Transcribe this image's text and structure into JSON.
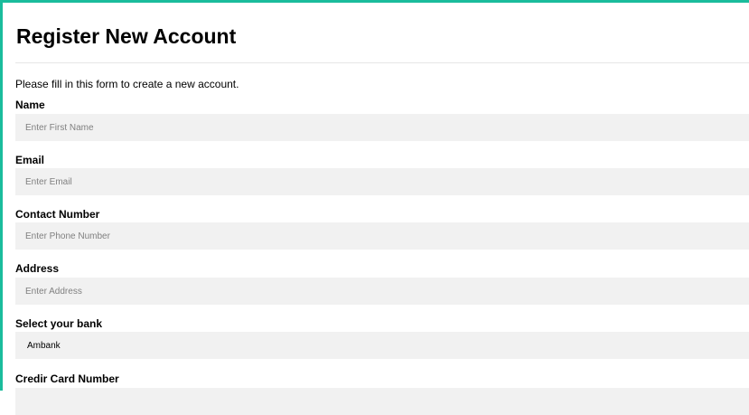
{
  "form": {
    "title": "Register New Account",
    "intro": "Please fill in this form to create a new account.",
    "name": {
      "label": "Name",
      "placeholder": "Enter First Name"
    },
    "email": {
      "label": "Email",
      "placeholder": "Enter Email"
    },
    "contact": {
      "label": "Contact Number",
      "placeholder": "Enter Phone Number"
    },
    "address": {
      "label": "Address",
      "placeholder": "Enter Address"
    },
    "bank": {
      "label": "Select your bank",
      "selected": "Ambank"
    },
    "card": {
      "label": "Credir Card Number"
    }
  },
  "colors": {
    "accent_border": "#1abc9c",
    "field_background": "#f1f1f1",
    "divider": "#e6e6e6"
  }
}
